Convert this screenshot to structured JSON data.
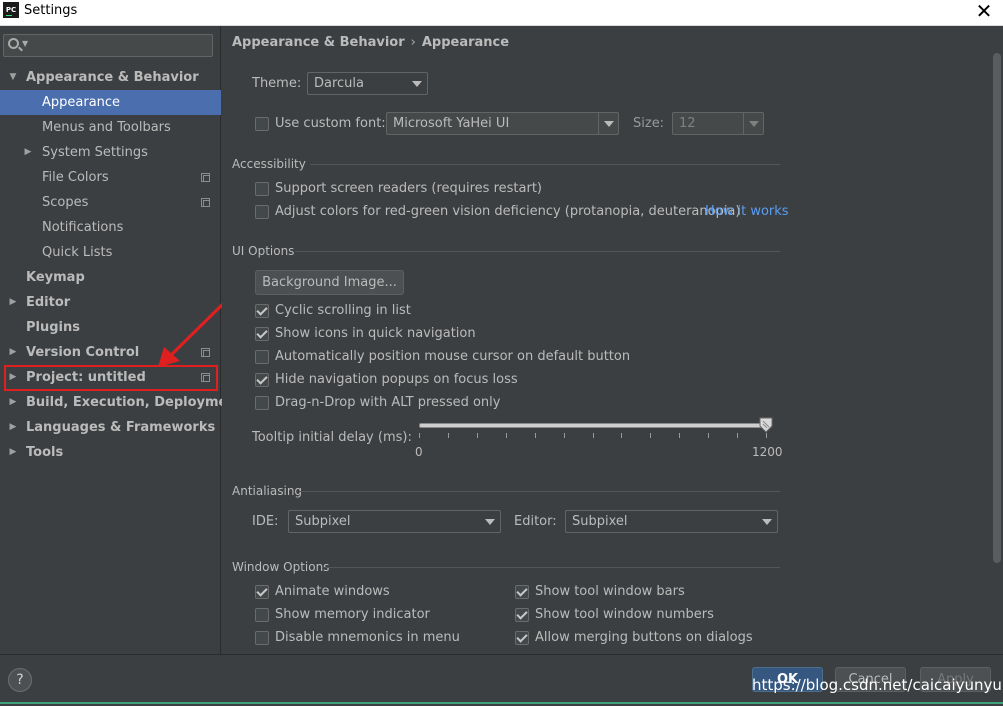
{
  "window": {
    "icon_text": "PC",
    "title": "Settings",
    "close_glyph": "✕"
  },
  "sidebar": {
    "search_placeholder": "",
    "items": [
      {
        "label": "Appearance & Behavior",
        "expander": "▼"
      },
      {
        "label": "Appearance"
      },
      {
        "label": "Menus and Toolbars"
      },
      {
        "label": "System Settings",
        "expander": "▶"
      },
      {
        "label": "File Colors"
      },
      {
        "label": "Scopes"
      },
      {
        "label": "Notifications"
      },
      {
        "label": "Quick Lists"
      },
      {
        "label": "Keymap"
      },
      {
        "label": "Editor",
        "expander": "▶"
      },
      {
        "label": "Plugins"
      },
      {
        "label": "Version Control",
        "expander": "▶"
      },
      {
        "label": "Project: untitled",
        "expander": "▶"
      },
      {
        "label": "Build, Execution, Deployment",
        "expander": "▶"
      },
      {
        "label": "Languages & Frameworks",
        "expander": "▶"
      },
      {
        "label": "Tools",
        "expander": "▶"
      }
    ],
    "annotation_color": "#e02020"
  },
  "breadcrumb": {
    "parent": "Appearance & Behavior",
    "separator": "›",
    "current": "Appearance"
  },
  "appearance": {
    "theme_label": "Theme:",
    "theme_value": "Darcula",
    "custom_font_label": "Use custom font:",
    "custom_font_checked": false,
    "font_value": "Microsoft YaHei UI",
    "size_label": "Size:",
    "size_value": "12"
  },
  "accessibility": {
    "section": "Accessibility",
    "screen_readers": {
      "label": "Support screen readers (requires restart)",
      "checked": false
    },
    "red_green": {
      "label": "Adjust colors for red-green vision deficiency (protanopia, deuteranopia)",
      "checked": false
    },
    "how_it_works": "How it works"
  },
  "ui_options": {
    "section": "UI Options",
    "background_button": "Background Image...",
    "cyclic": {
      "label": "Cyclic scrolling in list",
      "checked": true
    },
    "show_icons": {
      "label": "Show icons in quick navigation",
      "checked": true
    },
    "auto_position": {
      "label": "Automatically position mouse cursor on default button",
      "checked": false
    },
    "hide_popups": {
      "label": "Hide navigation popups on focus loss",
      "checked": true
    },
    "drag_drop": {
      "label": "Drag-n-Drop with ALT pressed only",
      "checked": false
    },
    "tooltip_label": "Tooltip initial delay (ms):",
    "slider_min": "0",
    "slider_max": "1200",
    "slider_value": 1200
  },
  "antialiasing": {
    "section": "Antialiasing",
    "ide_label": "IDE:",
    "ide_value": "Subpixel",
    "editor_label": "Editor:",
    "editor_value": "Subpixel"
  },
  "window_options": {
    "section": "Window Options",
    "animate": {
      "label": "Animate windows",
      "checked": true
    },
    "memory": {
      "label": "Show memory indicator",
      "checked": false
    },
    "mnemonics": {
      "label": "Disable mnemonics in menu",
      "checked": false
    },
    "tool_bars": {
      "label": "Show tool window bars",
      "checked": true
    },
    "tool_numbers": {
      "label": "Show tool window numbers",
      "checked": true
    },
    "merging": {
      "label": "Allow merging buttons on dialogs",
      "checked": true
    }
  },
  "footer": {
    "help": "?",
    "ok": "OK",
    "cancel": "Cancel",
    "apply": "Apply",
    "watermark": "https://blog.csdn.net/caicaiyunyun"
  },
  "colors": {
    "background": "#3c3f41",
    "selection": "#4b6eaf",
    "link": "#589df6",
    "primary_button": "#365880"
  }
}
